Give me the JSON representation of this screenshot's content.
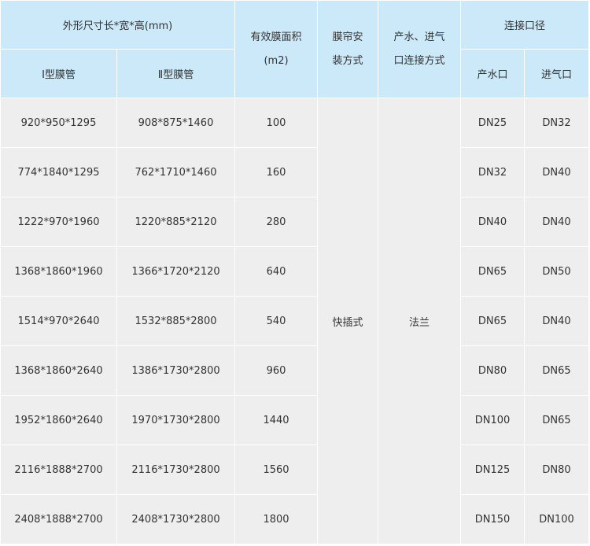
{
  "header": {
    "dimensions": "外形尺寸长*宽*高(mm)",
    "type1": "Ⅰ型膜管",
    "type2": "Ⅱ型膜管",
    "area_line1": "有效膜面积",
    "area_line2": "(m2)",
    "install_line1": "膜帘安",
    "install_line2": "装方式",
    "conn_line1": "产水、进气",
    "conn_line2": "口连接方式",
    "port_size": "连接口径",
    "outlet": "产水口",
    "inlet": "进气口"
  },
  "install_method": "快插式",
  "connection_method": "法兰",
  "rows": [
    {
      "type1": "920*950*1295",
      "type2": "908*875*1460",
      "area": "100",
      "outlet": "DN25",
      "inlet": "DN32"
    },
    {
      "type1": "774*1840*1295",
      "type2": "762*1710*1460",
      "area": "160",
      "outlet": "DN32",
      "inlet": "DN40"
    },
    {
      "type1": "1222*970*1960",
      "type2": "1220*885*2120",
      "area": "280",
      "outlet": "DN40",
      "inlet": "DN40"
    },
    {
      "type1": "1368*1860*1960",
      "type2": "1366*1720*2120",
      "area": "640",
      "outlet": "DN65",
      "inlet": "DN50"
    },
    {
      "type1": "1514*970*2640",
      "type2": "1532*885*2800",
      "area": "540",
      "outlet": "DN65",
      "inlet": "DN40"
    },
    {
      "type1": "1368*1860*2640",
      "type2": "1386*1730*2800",
      "area": "960",
      "outlet": "DN80",
      "inlet": "DN65"
    },
    {
      "type1": "1952*1860*2640",
      "type2": "1970*1730*2800",
      "area": "1440",
      "outlet": "DN100",
      "inlet": "DN65"
    },
    {
      "type1": "2116*1888*2700",
      "type2": "2116*1730*2800",
      "area": "1560",
      "outlet": "DN125",
      "inlet": "DN80"
    },
    {
      "type1": "2408*1888*2700",
      "type2": "2408*1730*2800",
      "area": "1800",
      "outlet": "DN150",
      "inlet": "DN100"
    }
  ]
}
